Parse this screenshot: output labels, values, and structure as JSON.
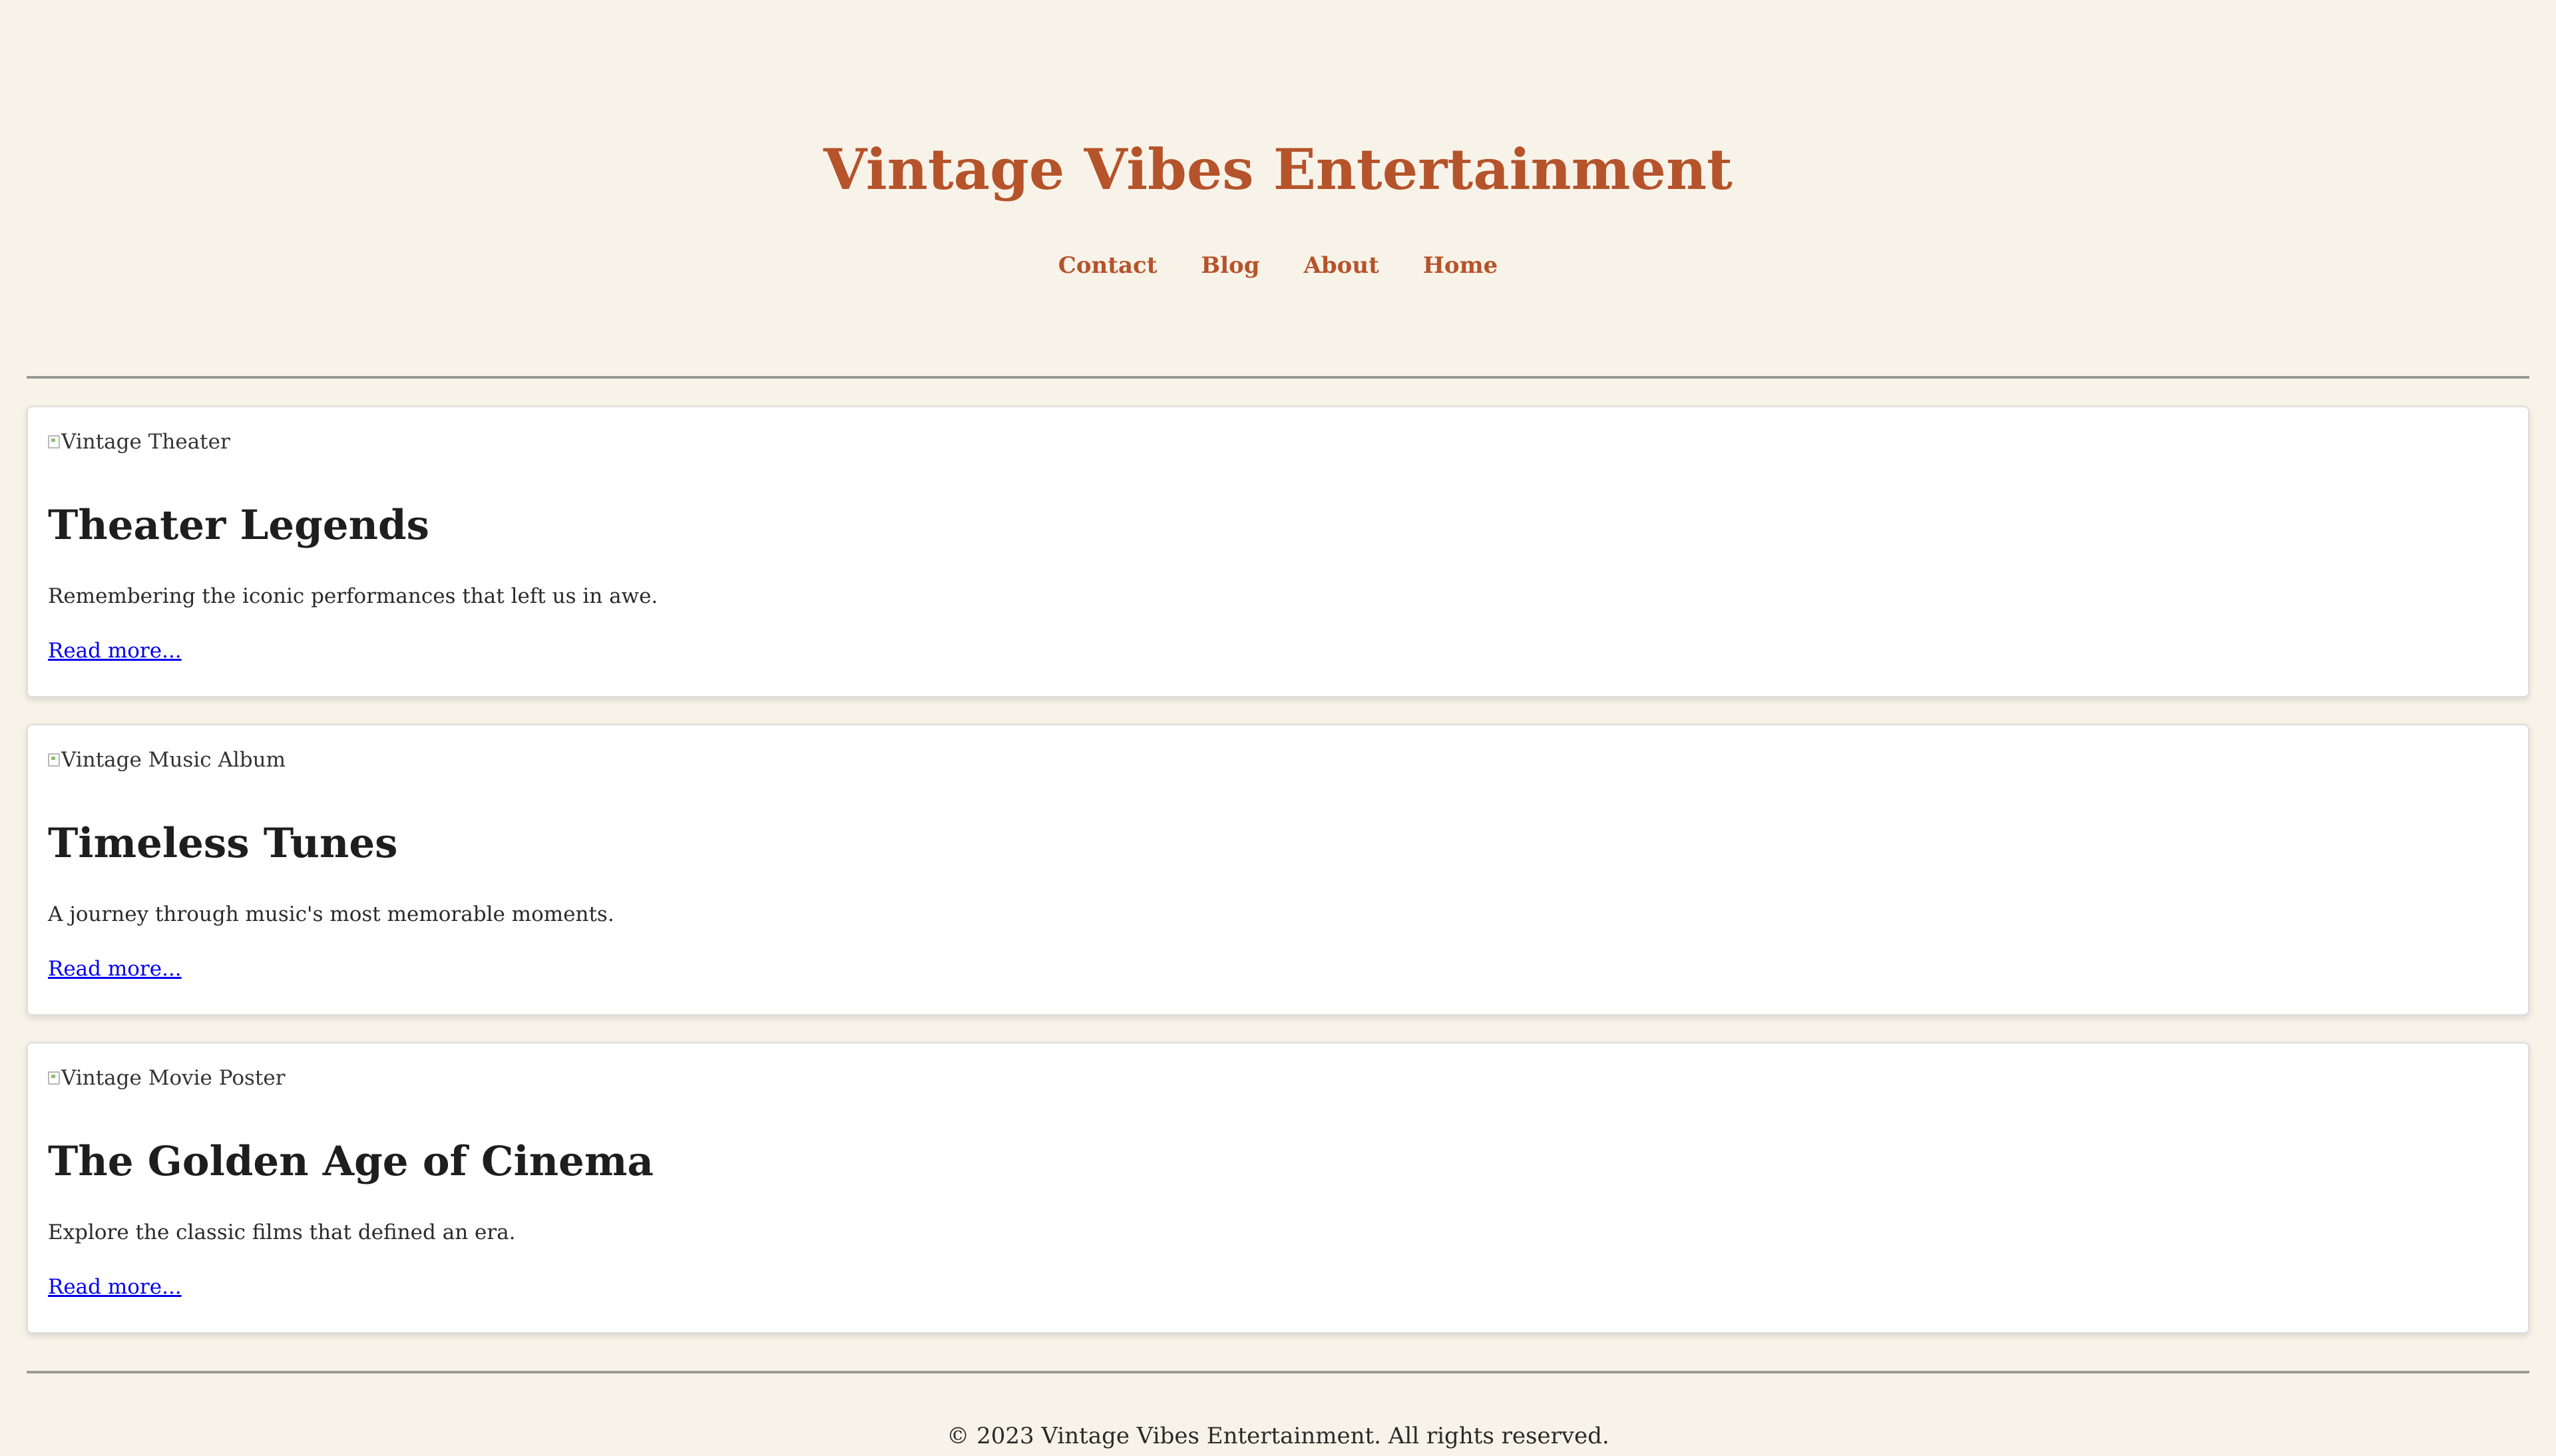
{
  "header": {
    "title": "Vintage Vibes Entertainment",
    "nav": [
      {
        "label": "Contact"
      },
      {
        "label": "Blog"
      },
      {
        "label": "About"
      },
      {
        "label": "Home"
      }
    ]
  },
  "cards": [
    {
      "image_alt": "Vintage Theater",
      "title": "Theater Legends",
      "description": "Remembering the iconic performances that left us in awe.",
      "link": "Read more..."
    },
    {
      "image_alt": "Vintage Music Album",
      "title": "Timeless Tunes",
      "description": "A journey through music's most memorable moments.",
      "link": "Read more..."
    },
    {
      "image_alt": "Vintage Movie Poster",
      "title": "The Golden Age of Cinema",
      "description": "Explore the classic films that defined an era.",
      "link": "Read more..."
    }
  ],
  "footer": {
    "text": "© 2023 Vintage Vibes Entertainment. All rights reserved."
  },
  "colors": {
    "background": "#f8f3e8",
    "accent": "#b5532b",
    "link": "#0000ee",
    "card_background": "#ffffff"
  }
}
